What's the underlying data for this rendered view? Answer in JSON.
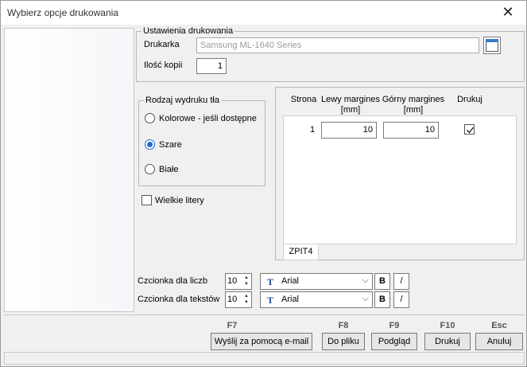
{
  "window": {
    "title": "Wybierz opcje drukowania",
    "close_symbol": "✕"
  },
  "settings": {
    "group_title": "Ustawienia drukowania",
    "printer_label": "Drukarka",
    "printer_value": "Samsung ML-1640 Series",
    "copies_label": "Ilość kopii",
    "copies_value": "1"
  },
  "background_type": {
    "group_title": "Rodzaj wydruku tła",
    "options": [
      {
        "label": "Kolorowe - jeśli dostępne",
        "selected": false
      },
      {
        "label": "Szare",
        "selected": true
      },
      {
        "label": "Białe",
        "selected": false
      }
    ]
  },
  "capitals": {
    "label": "Wielkie litery",
    "checked": false
  },
  "pages_grid": {
    "headers": {
      "page": "Strona",
      "left_margin": "Lewy margines\n[mm]",
      "top_margin": "Górny margines\n[mm]",
      "print": "Drukuj"
    },
    "rows": [
      {
        "page": "1",
        "left_margin": "10",
        "top_margin": "10",
        "print": true
      }
    ],
    "tab_label": "ZPIT4"
  },
  "fonts": {
    "numbers_label": "Czcionka dla liczb",
    "numbers_size": "10",
    "numbers_font": "Arial",
    "text_label": "Czcionka dla tekstów",
    "text_size": "10",
    "text_font": "Arial",
    "bold_label": "B",
    "italic_label": "/",
    "font_type_glyph": "T"
  },
  "footer": {
    "buttons": [
      {
        "key": "F7",
        "label": "Wyślij za pomocą e-mail"
      },
      {
        "key": "F8",
        "label": "Do pliku"
      },
      {
        "key": "F9",
        "label": "Podgląd"
      },
      {
        "key": "F10",
        "label": "Drukuj"
      },
      {
        "key": "Esc",
        "label": "Anuluj"
      }
    ]
  }
}
